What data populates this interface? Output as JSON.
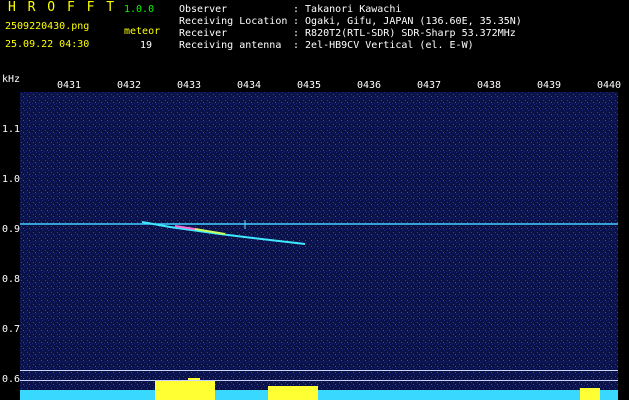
{
  "header": {
    "app_title": "H R O F F T",
    "app_version": "1.0.0",
    "file_name": "2509220430.png",
    "date_time": "25.09.22 04:30",
    "meteor_label": "meteor",
    "meteor_count": "19",
    "info": [
      {
        "key": "Observer",
        "value": ": Takanori Kawachi"
      },
      {
        "key": "Receiving Location",
        "value": ": Ogaki, Gifu, JAPAN (136.60E, 35.35N)"
      },
      {
        "key": "Receiver",
        "value": ": R820T2(RTL-SDR) SDR-Sharp 53.372MHz"
      },
      {
        "key": "Receiving antenna",
        "value": ": 2el-HB9CV Vertical (el. E-W)"
      }
    ]
  },
  "axes": {
    "y_label": "kHz",
    "x_ticks": [
      "0431",
      "0432",
      "0433",
      "0434",
      "0435",
      "0436",
      "0437",
      "0438",
      "0439",
      "0440"
    ],
    "y_ticks": [
      "1.1",
      "1.0",
      "0.9",
      "0.8",
      "0.7",
      "0.6"
    ]
  },
  "colors": {
    "background": "#000000",
    "spectrum": "#0a1248",
    "trace": "#00e5ff",
    "burst": "#ffff00",
    "text_yellow": "#ffff00",
    "text_green": "#00ff00"
  }
}
